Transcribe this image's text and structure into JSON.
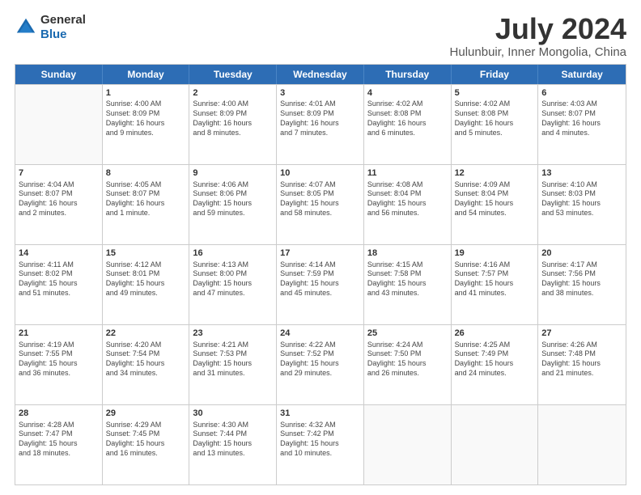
{
  "header": {
    "logo_general": "General",
    "logo_blue": "Blue",
    "title": "July 2024",
    "location": "Hulunbuir, Inner Mongolia, China"
  },
  "weekdays": [
    "Sunday",
    "Monday",
    "Tuesday",
    "Wednesday",
    "Thursday",
    "Friday",
    "Saturday"
  ],
  "rows": [
    [
      {
        "day": "",
        "sunrise": "",
        "sunset": "",
        "daylight": ""
      },
      {
        "day": "1",
        "sunrise": "Sunrise: 4:00 AM",
        "sunset": "Sunset: 8:09 PM",
        "daylight": "Daylight: 16 hours and 9 minutes."
      },
      {
        "day": "2",
        "sunrise": "Sunrise: 4:00 AM",
        "sunset": "Sunset: 8:09 PM",
        "daylight": "Daylight: 16 hours and 8 minutes."
      },
      {
        "day": "3",
        "sunrise": "Sunrise: 4:01 AM",
        "sunset": "Sunset: 8:09 PM",
        "daylight": "Daylight: 16 hours and 7 minutes."
      },
      {
        "day": "4",
        "sunrise": "Sunrise: 4:02 AM",
        "sunset": "Sunset: 8:08 PM",
        "daylight": "Daylight: 16 hours and 6 minutes."
      },
      {
        "day": "5",
        "sunrise": "Sunrise: 4:02 AM",
        "sunset": "Sunset: 8:08 PM",
        "daylight": "Daylight: 16 hours and 5 minutes."
      },
      {
        "day": "6",
        "sunrise": "Sunrise: 4:03 AM",
        "sunset": "Sunset: 8:07 PM",
        "daylight": "Daylight: 16 hours and 4 minutes."
      }
    ],
    [
      {
        "day": "7",
        "sunrise": "Sunrise: 4:04 AM",
        "sunset": "Sunset: 8:07 PM",
        "daylight": "Daylight: 16 hours and 2 minutes."
      },
      {
        "day": "8",
        "sunrise": "Sunrise: 4:05 AM",
        "sunset": "Sunset: 8:07 PM",
        "daylight": "Daylight: 16 hours and 1 minute."
      },
      {
        "day": "9",
        "sunrise": "Sunrise: 4:06 AM",
        "sunset": "Sunset: 8:06 PM",
        "daylight": "Daylight: 15 hours and 59 minutes."
      },
      {
        "day": "10",
        "sunrise": "Sunrise: 4:07 AM",
        "sunset": "Sunset: 8:05 PM",
        "daylight": "Daylight: 15 hours and 58 minutes."
      },
      {
        "day": "11",
        "sunrise": "Sunrise: 4:08 AM",
        "sunset": "Sunset: 8:04 PM",
        "daylight": "Daylight: 15 hours and 56 minutes."
      },
      {
        "day": "12",
        "sunrise": "Sunrise: 4:09 AM",
        "sunset": "Sunset: 8:04 PM",
        "daylight": "Daylight: 15 hours and 54 minutes."
      },
      {
        "day": "13",
        "sunrise": "Sunrise: 4:10 AM",
        "sunset": "Sunset: 8:03 PM",
        "daylight": "Daylight: 15 hours and 53 minutes."
      }
    ],
    [
      {
        "day": "14",
        "sunrise": "Sunrise: 4:11 AM",
        "sunset": "Sunset: 8:02 PM",
        "daylight": "Daylight: 15 hours and 51 minutes."
      },
      {
        "day": "15",
        "sunrise": "Sunrise: 4:12 AM",
        "sunset": "Sunset: 8:01 PM",
        "daylight": "Daylight: 15 hours and 49 minutes."
      },
      {
        "day": "16",
        "sunrise": "Sunrise: 4:13 AM",
        "sunset": "Sunset: 8:00 PM",
        "daylight": "Daylight: 15 hours and 47 minutes."
      },
      {
        "day": "17",
        "sunrise": "Sunrise: 4:14 AM",
        "sunset": "Sunset: 7:59 PM",
        "daylight": "Daylight: 15 hours and 45 minutes."
      },
      {
        "day": "18",
        "sunrise": "Sunrise: 4:15 AM",
        "sunset": "Sunset: 7:58 PM",
        "daylight": "Daylight: 15 hours and 43 minutes."
      },
      {
        "day": "19",
        "sunrise": "Sunrise: 4:16 AM",
        "sunset": "Sunset: 7:57 PM",
        "daylight": "Daylight: 15 hours and 41 minutes."
      },
      {
        "day": "20",
        "sunrise": "Sunrise: 4:17 AM",
        "sunset": "Sunset: 7:56 PM",
        "daylight": "Daylight: 15 hours and 38 minutes."
      }
    ],
    [
      {
        "day": "21",
        "sunrise": "Sunrise: 4:19 AM",
        "sunset": "Sunset: 7:55 PM",
        "daylight": "Daylight: 15 hours and 36 minutes."
      },
      {
        "day": "22",
        "sunrise": "Sunrise: 4:20 AM",
        "sunset": "Sunset: 7:54 PM",
        "daylight": "Daylight: 15 hours and 34 minutes."
      },
      {
        "day": "23",
        "sunrise": "Sunrise: 4:21 AM",
        "sunset": "Sunset: 7:53 PM",
        "daylight": "Daylight: 15 hours and 31 minutes."
      },
      {
        "day": "24",
        "sunrise": "Sunrise: 4:22 AM",
        "sunset": "Sunset: 7:52 PM",
        "daylight": "Daylight: 15 hours and 29 minutes."
      },
      {
        "day": "25",
        "sunrise": "Sunrise: 4:24 AM",
        "sunset": "Sunset: 7:50 PM",
        "daylight": "Daylight: 15 hours and 26 minutes."
      },
      {
        "day": "26",
        "sunrise": "Sunrise: 4:25 AM",
        "sunset": "Sunset: 7:49 PM",
        "daylight": "Daylight: 15 hours and 24 minutes."
      },
      {
        "day": "27",
        "sunrise": "Sunrise: 4:26 AM",
        "sunset": "Sunset: 7:48 PM",
        "daylight": "Daylight: 15 hours and 21 minutes."
      }
    ],
    [
      {
        "day": "28",
        "sunrise": "Sunrise: 4:28 AM",
        "sunset": "Sunset: 7:47 PM",
        "daylight": "Daylight: 15 hours and 18 minutes."
      },
      {
        "day": "29",
        "sunrise": "Sunrise: 4:29 AM",
        "sunset": "Sunset: 7:45 PM",
        "daylight": "Daylight: 15 hours and 16 minutes."
      },
      {
        "day": "30",
        "sunrise": "Sunrise: 4:30 AM",
        "sunset": "Sunset: 7:44 PM",
        "daylight": "Daylight: 15 hours and 13 minutes."
      },
      {
        "day": "31",
        "sunrise": "Sunrise: 4:32 AM",
        "sunset": "Sunset: 7:42 PM",
        "daylight": "Daylight: 15 hours and 10 minutes."
      },
      {
        "day": "",
        "sunrise": "",
        "sunset": "",
        "daylight": ""
      },
      {
        "day": "",
        "sunrise": "",
        "sunset": "",
        "daylight": ""
      },
      {
        "day": "",
        "sunrise": "",
        "sunset": "",
        "daylight": ""
      }
    ]
  ]
}
